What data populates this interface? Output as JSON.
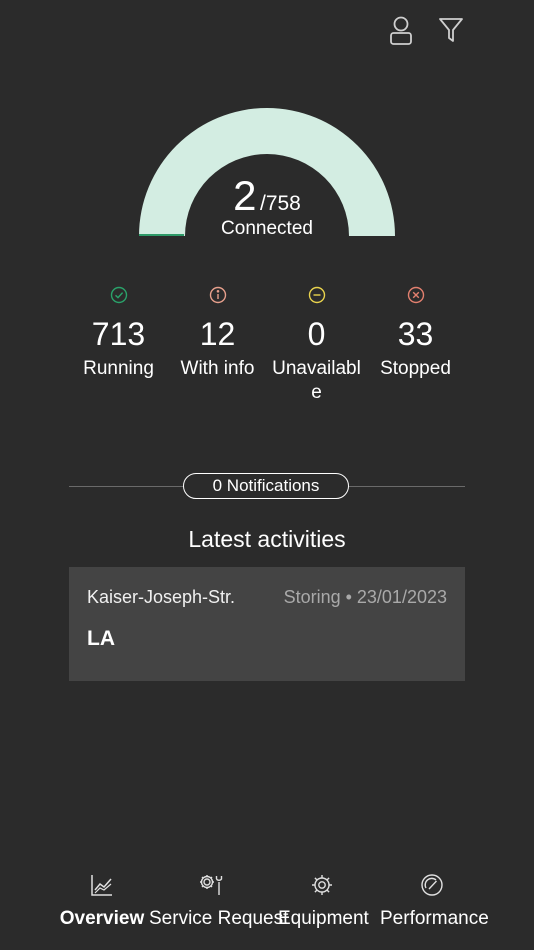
{
  "header": {
    "profile_icon": "user-icon",
    "filter_icon": "filter-icon"
  },
  "gauge": {
    "connected": "2",
    "total": "/758",
    "label": "Connected",
    "connected_fraction": 0.0026,
    "fill_color": "#d3ede2",
    "accent_color": "#2e9a68"
  },
  "stats": [
    {
      "icon": "check-circle-icon",
      "value": "713",
      "label": "Running",
      "color": "#2aa26a"
    },
    {
      "icon": "info-circle-icon",
      "value": "12",
      "label": "With info",
      "color": "#e7a08c"
    },
    {
      "icon": "minus-circle-icon",
      "value": "0",
      "label": "Unavailable",
      "color": "#e9d34d"
    },
    {
      "icon": "x-circle-icon",
      "value": "33",
      "label": "Stopped",
      "color": "#e3806f"
    }
  ],
  "notifications": {
    "label": "0 Notifications"
  },
  "activities": {
    "title": "Latest activities",
    "items": [
      {
        "location": "Kaiser-Joseph-Str.",
        "meta": "Storing • 23/01/2023",
        "code": "LA"
      }
    ]
  },
  "nav": {
    "overview": "Overview",
    "service_request": "Service Request",
    "equipment": "Equipment",
    "performance": "Performance"
  }
}
